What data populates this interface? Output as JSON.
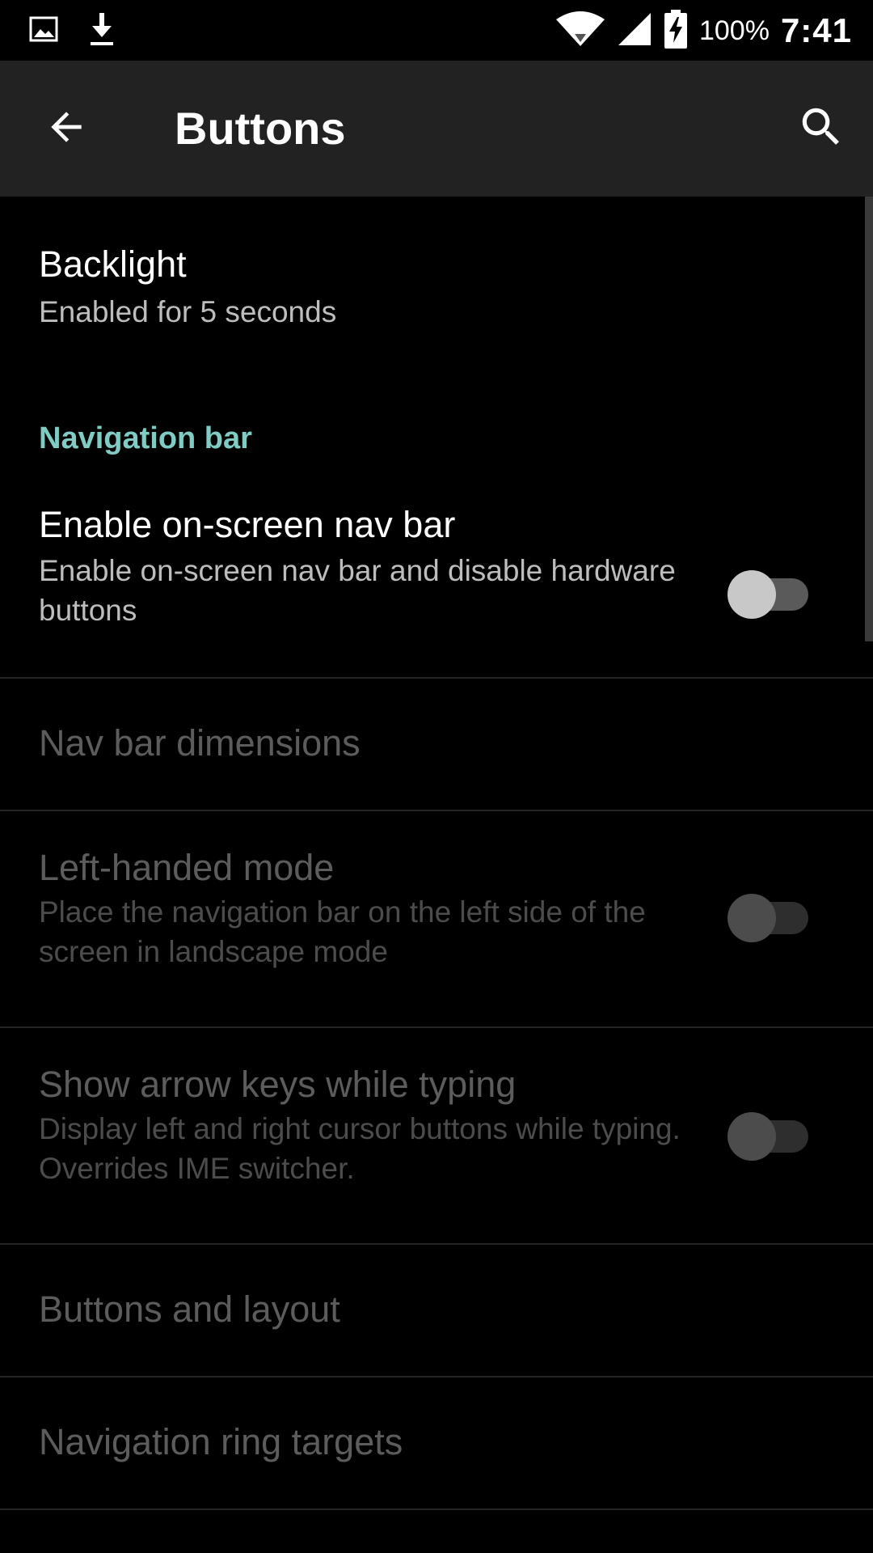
{
  "status_bar": {
    "left_icons": [
      "image-notification-icon",
      "download-notification-icon"
    ],
    "right_icons": [
      "wifi-icon",
      "cell-signal-icon",
      "battery-charging-icon"
    ],
    "battery": "100%",
    "time": "7:41"
  },
  "app_bar": {
    "title": "Buttons",
    "back_icon": "arrow-back-icon",
    "search_icon": "search-icon"
  },
  "preferences": {
    "backlight": {
      "title": "Backlight",
      "summary": "Enabled for 5 seconds"
    },
    "nav_category": "Navigation bar",
    "enable_nav_bar": {
      "title": "Enable on-screen nav bar",
      "summary": "Enable on-screen nav bar and disable hardware buttons",
      "enabled": true,
      "checked": false
    },
    "nav_bar_dimensions": {
      "title": "Nav bar dimensions",
      "enabled": false
    },
    "left_handed_mode": {
      "title": "Left-handed mode",
      "summary": "Place the navigation bar on the left side of the screen in landscape mode",
      "enabled": false,
      "checked": false
    },
    "show_arrow_keys": {
      "title": "Show arrow keys while typing",
      "summary": "Display left and right cursor buttons while typing. Overrides IME switcher.",
      "enabled": false,
      "checked": false
    },
    "buttons_and_layout": {
      "title": "Buttons and layout",
      "enabled": false
    },
    "navigation_ring_targets": {
      "title": "Navigation ring targets",
      "enabled": false
    }
  },
  "colors": {
    "background": "#000000",
    "app_bar": "#222222",
    "accent": "#80cbc4",
    "primary_text": "#ffffff",
    "secondary_text": "#bdbdbd",
    "disabled_text": "#5c5c5c"
  }
}
